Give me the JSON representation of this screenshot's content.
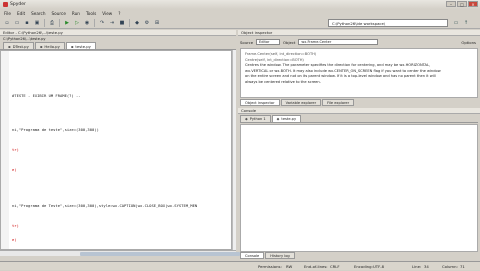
{
  "window": {
    "title": "Spyder",
    "min": "–",
    "max": "□",
    "close": "×"
  },
  "menu": [
    "File",
    "Edit",
    "Search",
    "Source",
    "Run",
    "Tools",
    "View",
    "?"
  ],
  "toolbar": {
    "icons": [
      "new-file-icon",
      "open-icon",
      "save-icon",
      "save-all-icon",
      "print-icon",
      "run-icon",
      "run-selection-icon",
      "debug-icon",
      "step-icon",
      "continue-icon",
      "stop-icon",
      "python-icon",
      "settings-icon",
      "pythonpath-icon"
    ],
    "path": "C:\\Python26\\ide workspace\\"
  },
  "editor": {
    "header": "Editor - C:\\Python26\\...\\teste.py",
    "path": "C:\\Python26\\...\\teste.py",
    "tabs": [
      {
        "label": "DTest.py",
        "active": false
      },
      {
        "label": "Hello.py",
        "active": false
      },
      {
        "label": "teste.py",
        "active": true
      }
    ],
    "lines": [
      {
        "text": "#TESTE - EXIBIR UM FRAME(?) --",
        "red": false
      },
      {
        "text": "ni,\"Programa de teste\",size=(300,300))",
        "red": false
      },
      {
        "text": "tr)",
        "red": true
      },
      {
        "text": "e)",
        "red": true
      },
      {
        "text": "ni,\"Programa de Teste\",size=(300,300),style=wx.CAPTION|wx.CLOSE_BOX|wx.SYSTEM_MEN",
        "red": false
      },
      {
        "text": "tr)",
        "red": true
      },
      {
        "text": "e)",
        "red": true
      }
    ]
  },
  "inspector": {
    "header": "Object inspector",
    "source_label": "Source",
    "source_value": "Editor",
    "object_label": "Object",
    "object_value": "wx.Frame.Center",
    "options": "Options",
    "doc_lines": [
      "Frame.Center(self, int_direction=BOTH)",
      "Centre(self, int_direction=BOTH)",
      "Centres the window. The parameter specifies the direction for centering, and may be wx.HORIZONTAL,",
      "wx.VERTICAL or wx.BOTH. It may also include wx.CENTER_ON_SCREEN flag if you want to center the window",
      "on the entire screen and not on its parent window. If it is a top-level window and has no parent then it will",
      "always be centered relative to the screen."
    ],
    "tabs": [
      {
        "label": "Object inspector",
        "active": true
      },
      {
        "label": "Variable explorer",
        "active": false
      },
      {
        "label": "File explorer",
        "active": false
      }
    ]
  },
  "console": {
    "header": "Console",
    "tabs": [
      {
        "label": "Python 1",
        "active": false
      },
      {
        "label": "teste.py",
        "active": true
      }
    ],
    "bottom_tabs": [
      {
        "label": "Console",
        "active": true
      },
      {
        "label": "History log",
        "active": false
      }
    ]
  },
  "status": {
    "permissions_label": "Permissions:",
    "permissions": "RW",
    "eol_label": "End-of-lines:",
    "eol": "CRLF",
    "encoding_label": "Encoding:",
    "encoding": "UTF-8",
    "line_label": "Line:",
    "line": "34",
    "column_label": "Column:",
    "column": "71"
  }
}
